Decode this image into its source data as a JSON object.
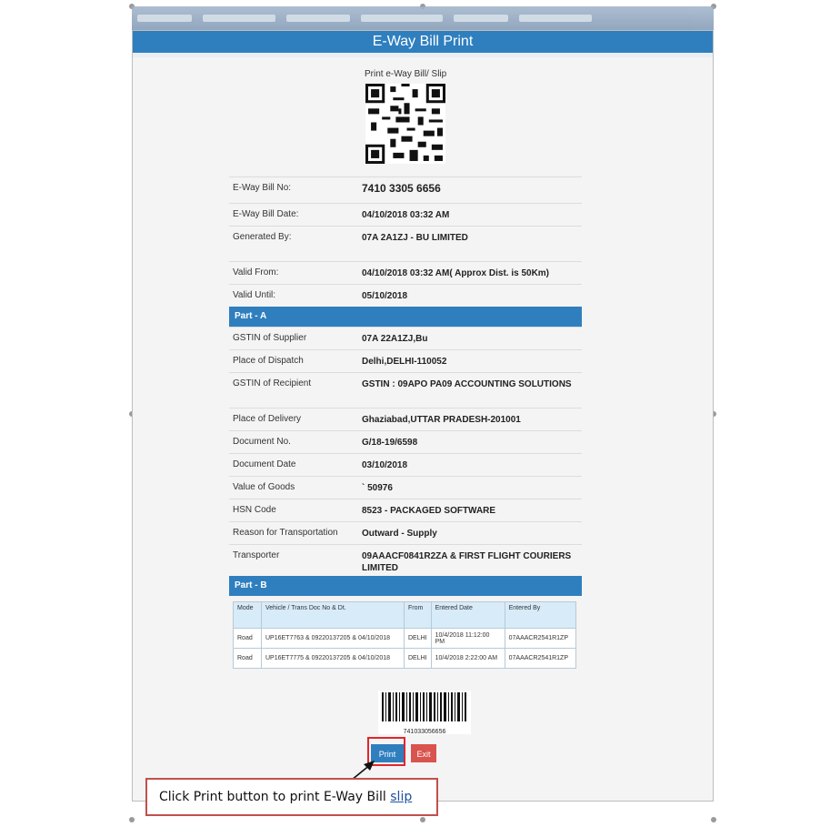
{
  "window": {
    "title": "E-Way Bill Print"
  },
  "slip": {
    "caption": "Print e-Way Bill/ Slip",
    "barcode_number": "741033056656"
  },
  "details": [
    {
      "label": "E-Way Bill No:",
      "value": "7410 3305 6656"
    },
    {
      "label": "E-Way Bill Date:",
      "value": "04/10/2018 03:32 AM"
    },
    {
      "label": "Generated By:",
      "value": "07A            2A1ZJ - BU                    LIMITED"
    },
    {
      "label": "Valid From:",
      "value": "04/10/2018 03:32 AM( Approx Dist. is 50Km)"
    },
    {
      "label": "Valid Until:",
      "value": "05/10/2018"
    }
  ],
  "part_a": {
    "title": "Part - A",
    "rows": [
      {
        "label": "GSTIN of Supplier",
        "value": "07A          22A1ZJ,Bu"
      },
      {
        "label": "Place of Dispatch",
        "value": "Delhi,DELHI-110052"
      },
      {
        "label": "GSTIN of Recipient",
        "value": "GSTIN : 09APO PA09          ACCOUNTING SOLUTIONS"
      },
      {
        "label": "Place of Delivery",
        "value": "Ghaziabad,UTTAR PRADESH-201001"
      },
      {
        "label": "Document No.",
        "value": "G/18-19/6598"
      },
      {
        "label": "Document Date",
        "value": "03/10/2018"
      },
      {
        "label": "Value of Goods",
        "value": "` 50976"
      },
      {
        "label": "HSN Code",
        "value": "8523 - PACKAGED SOFTWARE"
      },
      {
        "label": "Reason for Transportation",
        "value": "Outward - Supply"
      },
      {
        "label": "Transporter",
        "value": "09AAACF0841R2ZA & FIRST FLIGHT COURIERS LIMITED"
      }
    ]
  },
  "part_b": {
    "title": "Part - B",
    "columns": [
      "Mode",
      "Vehicle / Trans Doc No & Dt.",
      "From",
      "Entered Date",
      "Entered By"
    ],
    "rows": [
      [
        "Road",
        "UP16ET7763 & 09220137205 & 04/10/2018",
        "DELHI",
        "10/4/2018 11:12:00 PM",
        "07AAACR2541R1ZP"
      ],
      [
        "Road",
        "UP16ET7775 & 09220137205 & 04/10/2018",
        "DELHI",
        "10/4/2018 2:22:00 AM",
        "07AAACR2541R1ZP"
      ]
    ]
  },
  "buttons": {
    "print": "Print",
    "exit": "Exit"
  },
  "callout": {
    "text": "Click Print button to print E-Way Bill ",
    "link": "slip"
  },
  "colors": {
    "header": "#2f7fbf",
    "exit": "#d9534f",
    "highlight": "#e0262c"
  }
}
